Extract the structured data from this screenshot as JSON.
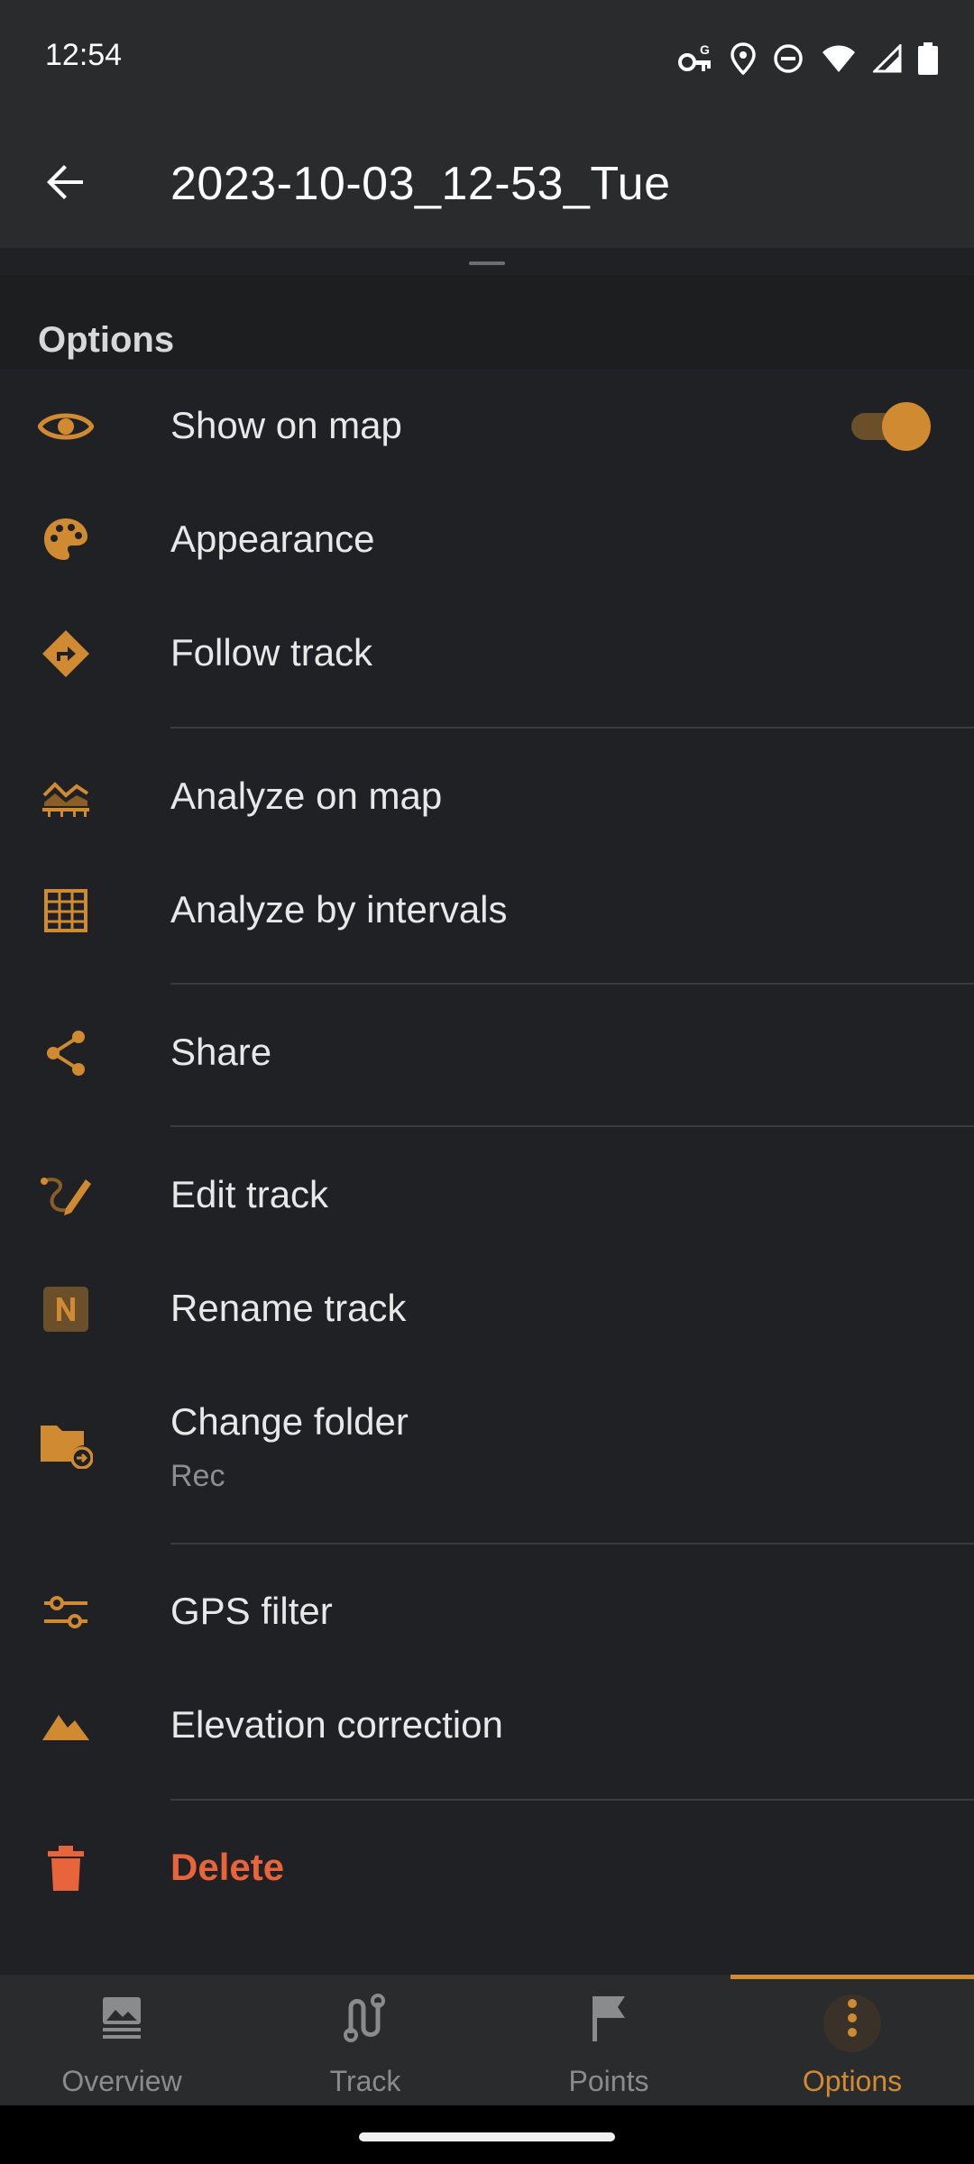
{
  "status_bar": {
    "time": "12:54",
    "icons": [
      "vpn-key-icon",
      "location-icon",
      "dnd-icon",
      "wifi-icon",
      "signal-icon",
      "battery-icon"
    ]
  },
  "app_bar": {
    "title": "2023-10-03_12-53_Tue",
    "back_icon": "arrow-back-icon"
  },
  "section": {
    "title": "Options"
  },
  "menu": {
    "show_on_map": {
      "label": "Show on map",
      "toggle_on": true
    },
    "appearance": {
      "label": "Appearance"
    },
    "follow_track": {
      "label": "Follow track"
    },
    "analyze_on_map": {
      "label": "Analyze on map"
    },
    "analyze_intervals": {
      "label": "Analyze by intervals"
    },
    "share": {
      "label": "Share"
    },
    "edit_track": {
      "label": "Edit track"
    },
    "rename_track": {
      "label": "Rename track"
    },
    "change_folder": {
      "label": "Change folder",
      "sublabel": "Rec"
    },
    "gps_filter": {
      "label": "GPS filter"
    },
    "elevation_correction": {
      "label": "Elevation correction"
    },
    "delete": {
      "label": "Delete"
    }
  },
  "bottom_nav": {
    "tabs": [
      {
        "label": "Overview",
        "icon": "overview-icon",
        "active": false
      },
      {
        "label": "Track",
        "icon": "track-icon",
        "active": false
      },
      {
        "label": "Points",
        "icon": "flag-icon",
        "active": false
      },
      {
        "label": "Options",
        "icon": "more-vert-icon",
        "active": true
      }
    ]
  },
  "colors": {
    "accent": "#d08a32",
    "delete": "#e8643a",
    "background": "#202124",
    "bar": "#2a2b2d"
  }
}
